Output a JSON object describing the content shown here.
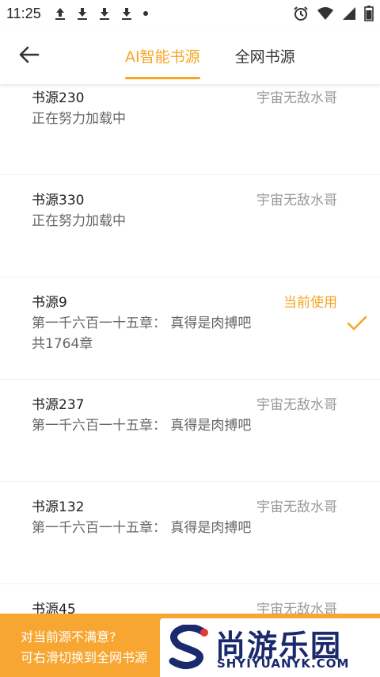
{
  "status_bar": {
    "time": "11:25"
  },
  "tabs": [
    {
      "label": "AI智能书源",
      "active": true
    },
    {
      "label": "全网书源",
      "active": false
    }
  ],
  "sources": [
    {
      "name": "书源230",
      "author": "宇宙无敌水哥",
      "lines": [
        "正在努力加载中"
      ],
      "current": false
    },
    {
      "name": "书源330",
      "author": "宇宙无敌水哥",
      "lines": [
        "正在努力加载中"
      ],
      "current": false
    },
    {
      "name": "书源9",
      "author": "当前使用",
      "lines": [
        "第一千六百一十五章： 真得是肉搏吧",
        "共1764章"
      ],
      "current": true
    },
    {
      "name": "书源237",
      "author": "宇宙无敌水哥",
      "lines": [
        "第一千六百一十五章： 真得是肉搏吧"
      ],
      "current": false
    },
    {
      "name": "书源132",
      "author": "宇宙无敌水哥",
      "lines": [
        "第一千六百一十五章： 真得是肉搏吧"
      ],
      "current": false
    },
    {
      "name": "书源45",
      "author": "宇宙无敌水哥",
      "lines": [],
      "current": false
    }
  ],
  "banner": {
    "line1": "对当前源不满意?",
    "line2": "可右滑切换到全网书源",
    "logo_text": "尚游乐园",
    "logo_sub": "SHYIYUANYK.COM"
  },
  "colors": {
    "accent": "#f5a623",
    "banner": "#f7a632",
    "logo": "#1a2a6c"
  }
}
